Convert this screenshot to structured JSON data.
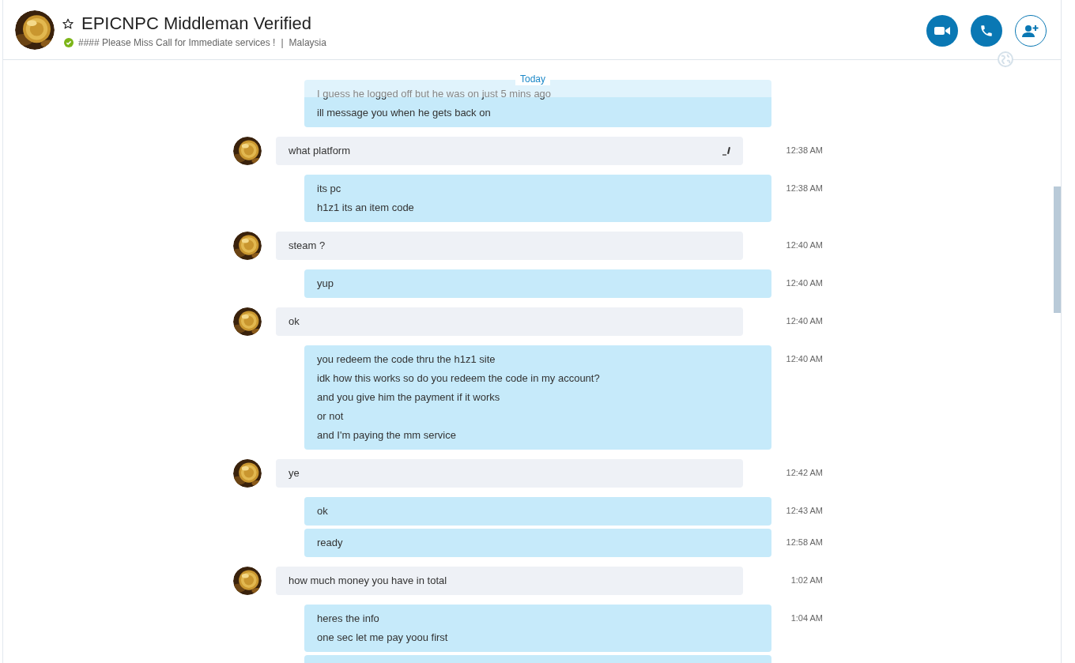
{
  "header": {
    "title": "EPICNPC Middleman Verified",
    "favorite": false,
    "online": true,
    "status": "#### Please Miss Call for Immediate services !",
    "separator": "|",
    "location": "Malaysia"
  },
  "date_divider": "Today",
  "messages": [
    {
      "kind": "out",
      "faded_lines": [
        "I guess he logged off but he was on just 5 mins ago"
      ],
      "lines": [
        "ill message you when he gets back on"
      ]
    },
    {
      "kind": "in",
      "lines": [
        "what platform"
      ],
      "time": "12:38 AM",
      "edited": true
    },
    {
      "kind": "out",
      "lines": [
        "its pc",
        "h1z1 its an item code"
      ],
      "time": "12:38 AM"
    },
    {
      "kind": "in",
      "lines": [
        "steam ?"
      ],
      "time": "12:40 AM"
    },
    {
      "kind": "out",
      "lines": [
        "yup"
      ],
      "time": "12:40 AM"
    },
    {
      "kind": "in",
      "lines": [
        "ok"
      ],
      "time": "12:40 AM"
    },
    {
      "kind": "out",
      "lines": [
        "you redeem the code thru the h1z1 site",
        "idk how this works so do you redeem the code in my account?",
        "and you give him the payment if it works",
        "or not",
        "and I'm paying the mm service"
      ],
      "time": "12:40 AM"
    },
    {
      "kind": "in",
      "lines": [
        "ye"
      ],
      "time": "12:42 AM"
    },
    {
      "kind": "out",
      "lines": [
        "ok"
      ],
      "time": "12:43 AM"
    },
    {
      "kind": "out",
      "lines": [
        "ready"
      ],
      "time": "12:58 AM"
    },
    {
      "kind": "in",
      "lines": [
        "how much money you have in total"
      ],
      "time": "1:02 AM"
    },
    {
      "kind": "out",
      "lines": [
        "heres the info",
        "one sec let me pay yoou first"
      ],
      "time": "1:04 AM"
    },
    {
      "kind": "out"
    }
  ]
}
